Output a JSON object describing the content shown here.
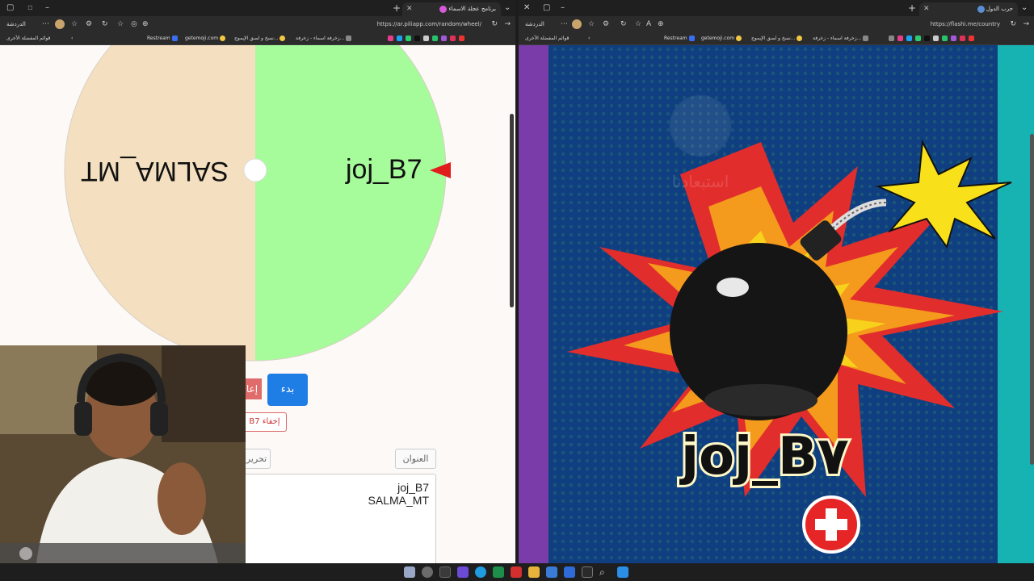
{
  "left_window": {
    "tab_title": "برنامج عجلة الاسماء",
    "url": "https://ar.piliapp.com/random/wheel/",
    "chat_label": "الدردشة",
    "other_favorites": "قوائم المفضلة الأخرى",
    "bookmarks": [
      "Restream",
      "getemoji.com",
      "نسخ و لصق الإيموج...",
      "زخرفة اسماء - زخرفة..."
    ],
    "wheel": {
      "segments": [
        {
          "label": "joj_B7",
          "color": "#a6fb9a"
        },
        {
          "label": "SALMA_MT",
          "color": "#f4e0c0"
        }
      ],
      "pointer_color": "#e11c1c"
    },
    "buttons": {
      "start": "بدء",
      "reset": "إعا",
      "hide": "إخفاء B7",
      "title": "العنوان",
      "edit": "تحرير"
    },
    "names_list": [
      "joj_B7",
      "SALMA_MT"
    ]
  },
  "right_window": {
    "tab_title": "حرب الدول",
    "url": "https://flashi.me/country",
    "chat_label": "الدردشة",
    "other_favorites": "قوائم المفضلة الأخرى",
    "bookmarks": [
      "Restream",
      "getemoji.com",
      "نسخ و لصق الإيموج...",
      "زخرفة اسماء - زخرفة..."
    ],
    "game": {
      "player_name": "joj_B٧",
      "faded_watermark": "استبعادنا",
      "badge": "plus-badge"
    }
  },
  "webcam": {
    "description": "streamer-webcam"
  }
}
